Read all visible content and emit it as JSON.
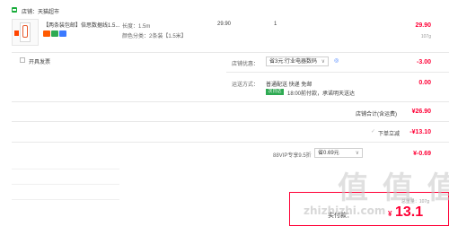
{
  "store": {
    "label": "店铺：",
    "name": "天猫超市"
  },
  "product": {
    "title": "【两条装包邮】倍思数据线1.5...",
    "spec_length": "长度：1.5m",
    "spec_color": "颜色分类：2条装【1.5米】",
    "unit_price": "29.90",
    "quantity": "1",
    "subtotal": "29.90",
    "weight": "107g"
  },
  "invoice": {
    "label": "开具发票"
  },
  "discount": {
    "label": "店铺优惠：",
    "selected": "省3元:行业电器数码",
    "amount": "-3.00"
  },
  "shipping": {
    "label": "运送方式：",
    "method": "普通配送 快递 免邮",
    "badge": "次日达",
    "note": "18:00前付款，承诺明天送达",
    "amount": "0.00"
  },
  "store_total": {
    "label": "店铺合计(含运费)",
    "amount": "¥26.90"
  },
  "instant_discount": {
    "label": "下单立减",
    "amount": "-¥13.10"
  },
  "vip": {
    "label": "88VIP专享9.5折",
    "selected": "省0.69元",
    "amount": "¥-0.69"
  },
  "summary": {
    "weight": "总重量：107g",
    "label": "实付款：",
    "amount": "13.1"
  },
  "watermark": {
    "text": "值 值 值",
    "site": "zhizhizhi.com"
  },
  "colors": {
    "accent": "#ff0036",
    "brand_green": "#1aad3c",
    "border": "#e8e8e8"
  }
}
